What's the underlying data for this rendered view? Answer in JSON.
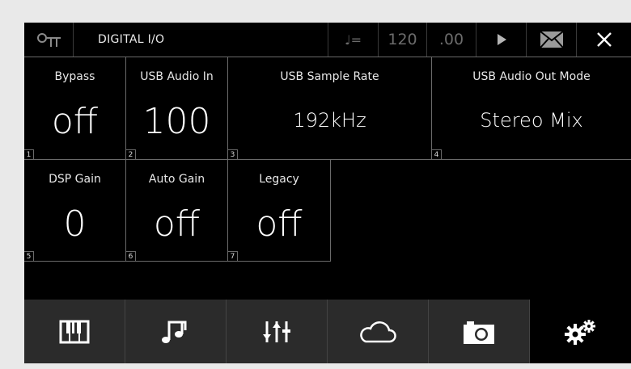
{
  "header": {
    "title": "DIGITAL I/O",
    "tempo_symbol": "♩=",
    "tempo_value": "120",
    "tempo_decimal": ".00",
    "icons": {
      "logo": "hub-icon",
      "play": "play-icon",
      "mail": "mail-icon",
      "close": "close-icon"
    }
  },
  "tiles": [
    {
      "index": "1",
      "label": "Bypass",
      "value": "off"
    },
    {
      "index": "2",
      "label": "USB Audio In",
      "value": "100"
    },
    {
      "index": "3",
      "label": "USB Sample Rate",
      "value": "192kHz"
    },
    {
      "index": "4",
      "label": "USB Audio Out Mode",
      "value": "Stereo Mix"
    },
    {
      "index": "5",
      "label": "DSP Gain",
      "value": "0"
    },
    {
      "index": "6",
      "label": "Auto Gain",
      "value": "off"
    },
    {
      "index": "7",
      "label": "Legacy",
      "value": "off"
    }
  ],
  "nav": [
    {
      "icon": "piano-keys-icon"
    },
    {
      "icon": "music-note-icon"
    },
    {
      "icon": "mixer-sliders-icon"
    },
    {
      "icon": "cloud-icon"
    },
    {
      "icon": "camera-icon"
    },
    {
      "icon": "settings-gears-icon",
      "active": true
    }
  ],
  "colors": {
    "background": "#000000",
    "navbar": "#2b2b2b",
    "dim_text": "#6b6b6b",
    "frame": "#e9e9e9"
  }
}
